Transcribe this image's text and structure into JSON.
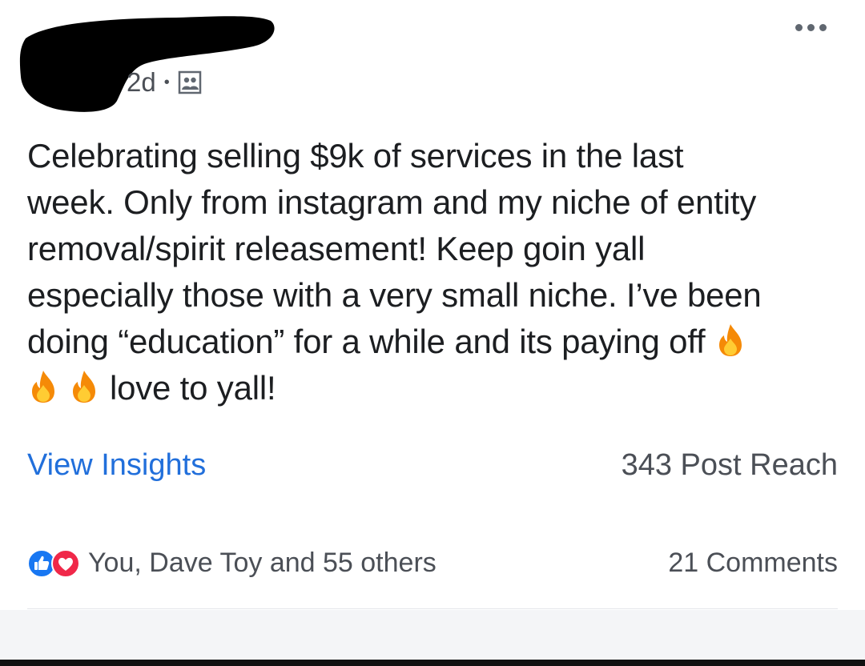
{
  "post": {
    "timestamp": "2d",
    "separator": "•",
    "audience_icon": "friends-icon",
    "menu_icon": "more-options-icon",
    "text": {
      "line1": "Celebrating selling $9k of services in the last",
      "line2": "week. Only from instagram and my niche of entity",
      "line3": "removal/spirit releasement! Keep goin yall",
      "line4": "especially those with a very small niche. I’ve been",
      "line5": "doing “education” for a while and its paying off",
      "line6": "love to yall!"
    },
    "emoji": "fire-icon"
  },
  "insights": {
    "link_label": "View Insights",
    "reach_label": "343 Post Reach"
  },
  "reactions": {
    "summary": "You, Dave Toy and 55 others",
    "icons": [
      "like-icon",
      "love-icon"
    ],
    "comments_label": "21 Comments"
  },
  "colors": {
    "link_blue": "#216fdb",
    "like_blue": "#1877f2",
    "love_red": "#f02849",
    "text_dark": "#1c1e21",
    "text_gray": "#4b4f56"
  }
}
